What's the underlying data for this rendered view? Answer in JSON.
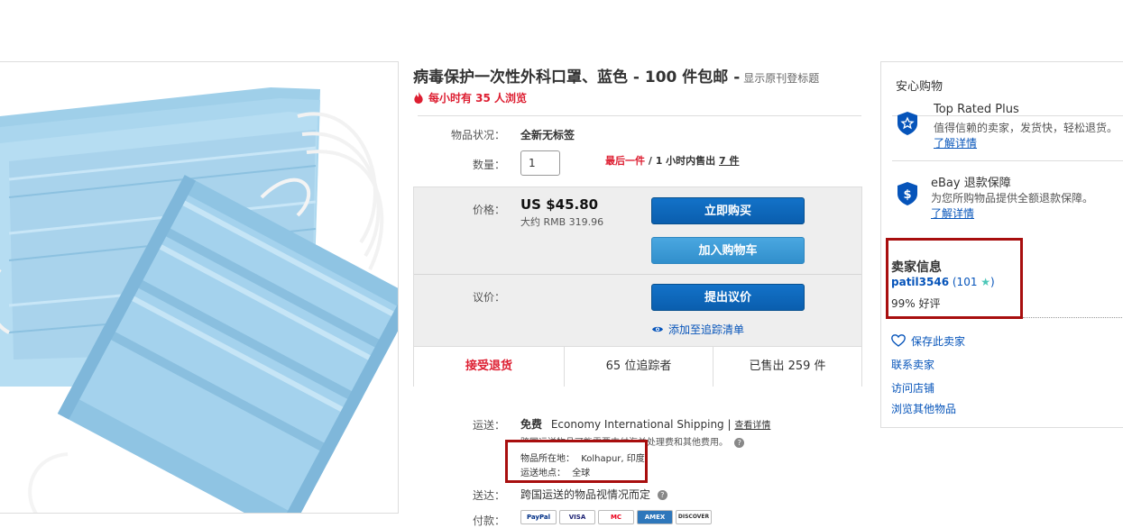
{
  "listing": {
    "title": "病毒保护一次性外科口罩、蓝色 - 100 件包邮 -",
    "show_original": "显示原刊登标题",
    "views": "每小时有 35 人浏览"
  },
  "details": {
    "condition_label": "物品状况：",
    "condition_value": "全新无标签",
    "quantity_label": "数量：",
    "quantity_value": "1",
    "last_one": "最后一件",
    "sold_sep": " / ",
    "sold_prefix": "1 小时内售出 ",
    "sold_count": "7 件"
  },
  "price": {
    "label": "价格：",
    "value": "US $45.80",
    "approx": "大约 RMB 319.96",
    "buy_now": "立即购买",
    "add_to_cart": "加入购物车",
    "offer_label": "议价：",
    "make_offer": "提出议价",
    "add_watch": "添加至追踪清单"
  },
  "stats": {
    "returns": "接受退货",
    "watchers": "65 位追踪者",
    "sold": "已售出 259 件"
  },
  "shipping": {
    "label": "运送：",
    "free": "免费",
    "method": "Economy International Shipping |",
    "details_link": "查看详情",
    "note": "跨国运送物品可能需要支付海关处理费和其他费用。",
    "location_label": "物品所在地：",
    "location_value": "Kolhapur, 印度",
    "ships_to_label": "运送地点：",
    "ships_to_value": "全球",
    "delivery_label": "送达：",
    "delivery_value": "跨国运送的物品视情况而定",
    "payment_label": "付款：",
    "payment_methods": [
      "PayPal",
      "VISA",
      "MC",
      "AMEX",
      "DISCOVER"
    ]
  },
  "trust": {
    "header": "安心购物",
    "top_rated_title": "Top Rated Plus",
    "top_rated_desc": "值得信赖的卖家，发货快，轻松退货。",
    "top_rated_link": "了解详情",
    "refund_title": "eBay 退款保障",
    "refund_desc": "为您所购物品提供全额退款保障。",
    "refund_link": "了解详情"
  },
  "seller": {
    "header": "卖家信息",
    "name": "patil3546",
    "rating_open": " (101 ",
    "rating_close": ")",
    "positive": "99% 好评",
    "save_seller": "保存此卖家",
    "contact": "联系卖家",
    "visit_store": "访问店铺",
    "other_items": "浏览其他物品"
  },
  "colors": {
    "link": "#0654ba",
    "alert_red": "#dd1e31",
    "highlight_box": "#a80e0e",
    "button_dark": "#0a5fb4",
    "button_light": "#3b9ad7"
  }
}
